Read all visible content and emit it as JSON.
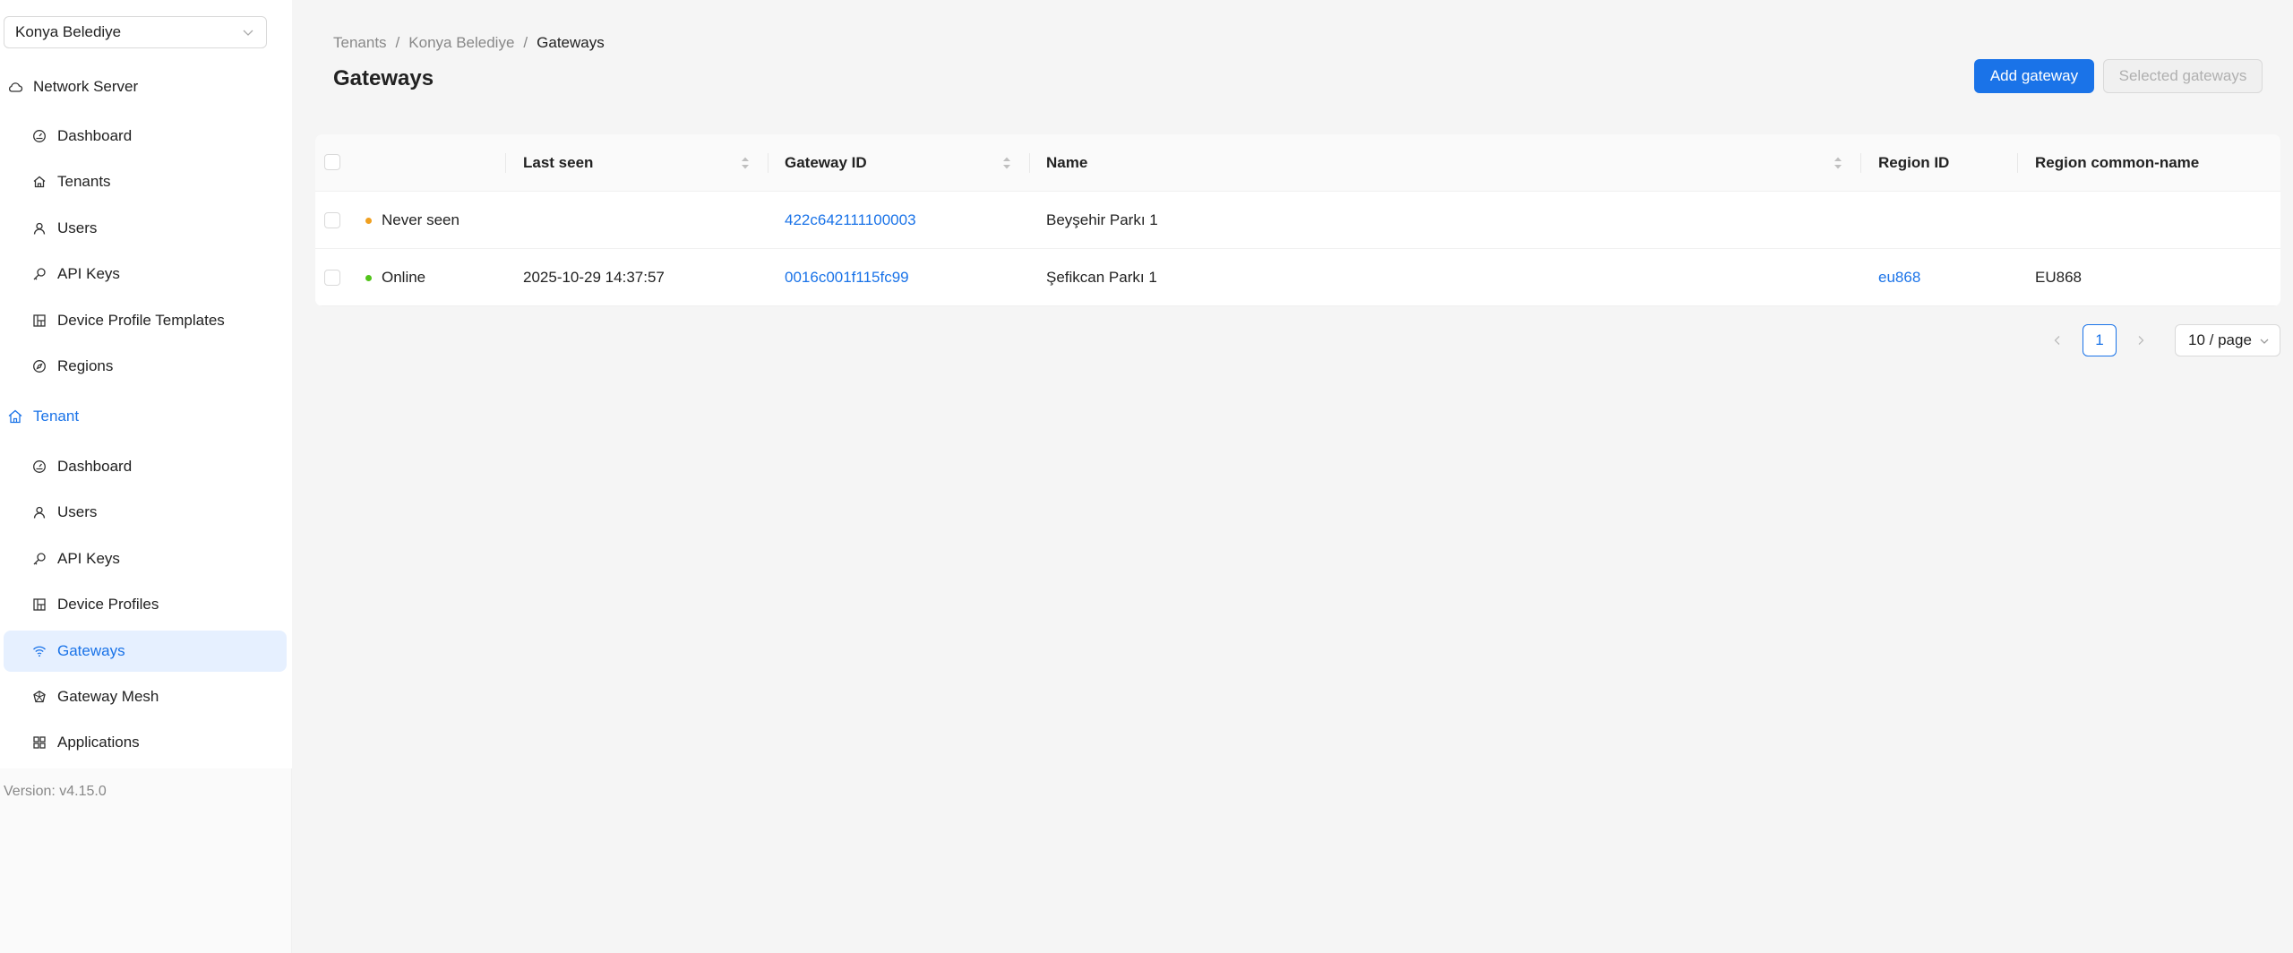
{
  "sidebar": {
    "tenant_select_value": "Konya Belediye",
    "network_server": {
      "label": "Network Server",
      "icon": "cloud-icon",
      "items": [
        {
          "label": "Dashboard",
          "icon": "dashboard-icon"
        },
        {
          "label": "Tenants",
          "icon": "home-icon"
        },
        {
          "label": "Users",
          "icon": "user-icon"
        },
        {
          "label": "API Keys",
          "icon": "key-icon"
        },
        {
          "label": "Device Profile Templates",
          "icon": "template-icon"
        },
        {
          "label": "Regions",
          "icon": "compass-icon"
        }
      ]
    },
    "tenant": {
      "label": "Tenant",
      "icon": "home-icon",
      "items": [
        {
          "label": "Dashboard",
          "icon": "dashboard-icon"
        },
        {
          "label": "Users",
          "icon": "user-icon"
        },
        {
          "label": "API Keys",
          "icon": "key-icon"
        },
        {
          "label": "Device Profiles",
          "icon": "template-icon"
        },
        {
          "label": "Gateways",
          "icon": "wifi-icon",
          "selected": true
        },
        {
          "label": "Gateway Mesh",
          "icon": "mesh-icon"
        },
        {
          "label": "Applications",
          "icon": "apps-icon"
        }
      ]
    },
    "version": "Version: v4.15.0"
  },
  "breadcrumb": [
    "Tenants",
    "Konya Belediye",
    "Gateways"
  ],
  "page_title": "Gateways",
  "buttons": {
    "add_gateway": "Add gateway",
    "selected_gateways": "Selected gateways"
  },
  "table": {
    "columns": [
      "Last seen",
      "Gateway ID",
      "Name",
      "Region ID",
      "Region common-name"
    ],
    "rows": [
      {
        "status": "Never seen",
        "status_color": "#f0a020",
        "last_seen": "",
        "gateway_id": "422c642111100003",
        "name": "Beyşehir Parkı 1",
        "region_id": "",
        "region_common_name": ""
      },
      {
        "status": "Online",
        "status_color": "#52c41a",
        "last_seen": "2025-10-29 14:37:57",
        "gateway_id": "0016c001f115fc99",
        "name": "Şefikcan Parkı 1",
        "region_id": "eu868",
        "region_common_name": "EU868"
      }
    ]
  },
  "pagination": {
    "prev": "<",
    "current_page": "1",
    "next": ">",
    "page_size": "10 / page"
  },
  "colors": {
    "accent": "#1a73e8"
  }
}
